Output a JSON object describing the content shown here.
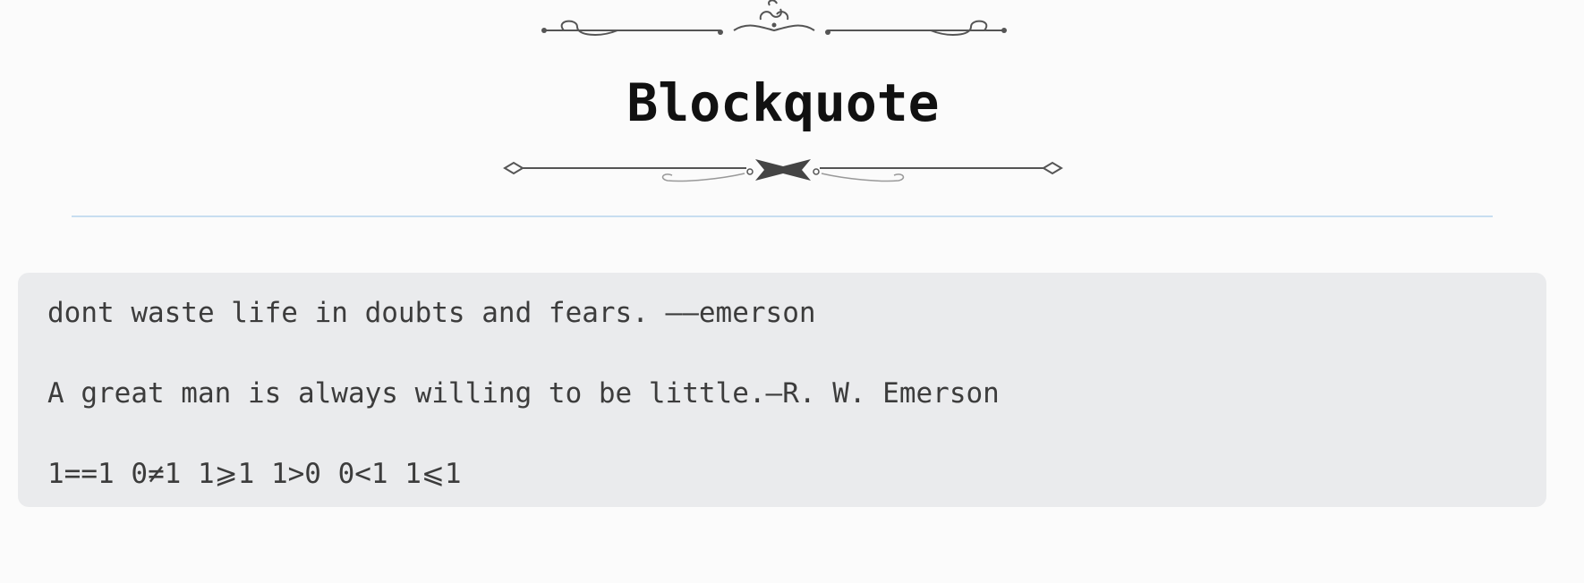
{
  "heading": {
    "title": "Blockquote"
  },
  "blockquote": {
    "lines": [
      "dont waste life in doubts and fears. ——emerson",
      "A great man is always willing to be little.—R. W. Emerson",
      "1==1 0≠1 1⩾1 1>0 0<1 1⩽1"
    ]
  },
  "decorations": {
    "top_ornament": "scroll-flourish-ornament",
    "bottom_ornament": "bowtie-flourish-ornament",
    "divider_color": "#c7def0",
    "blockquote_background": "#eaebed",
    "text_color": "#3c3c3c"
  }
}
